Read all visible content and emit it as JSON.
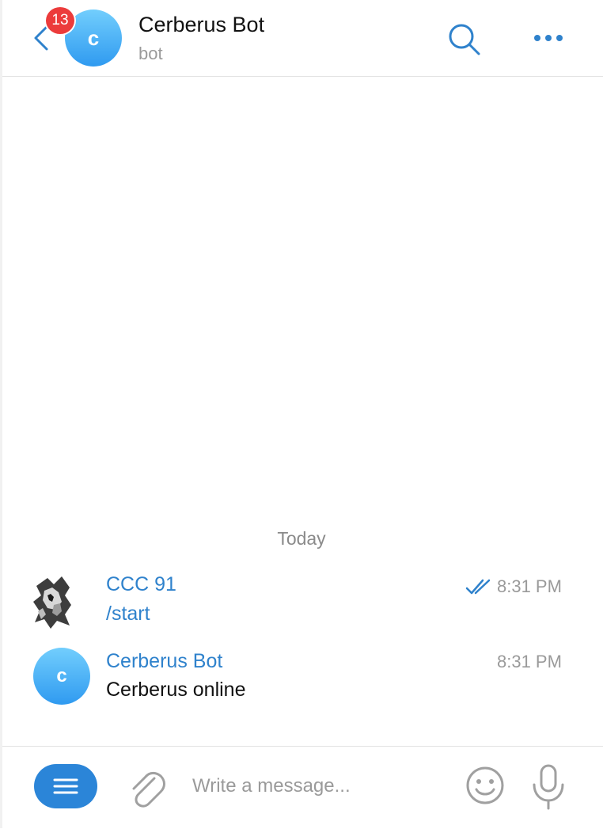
{
  "header": {
    "unread_count": "13",
    "avatar_letter": "c",
    "title": "Cerberus Bot",
    "subtitle": "bot",
    "back_icon": "chevron-left-icon",
    "search_icon": "search-icon",
    "more_icon": "more-horizontal-icon"
  },
  "chat": {
    "date_separator": "Today",
    "messages": [
      {
        "sender": "CCC 91",
        "text": "/start",
        "time": "8:31 PM",
        "status": "read",
        "avatar": "user-photo"
      },
      {
        "sender": "Cerberus Bot",
        "text": "Cerberus online",
        "time": "8:31 PM",
        "avatar_letter": "c"
      }
    ]
  },
  "composer": {
    "placeholder": "Write a message...",
    "menu_icon": "menu-icon",
    "attach_icon": "paperclip-icon",
    "emoji_icon": "smiley-icon",
    "mic_icon": "microphone-icon"
  },
  "colors": {
    "accent": "#2f82cc",
    "badge": "#ec3b3b",
    "avatar_top": "#72cefd",
    "avatar_bottom": "#2f9af0",
    "secondary_text": "#9a9a9a"
  }
}
